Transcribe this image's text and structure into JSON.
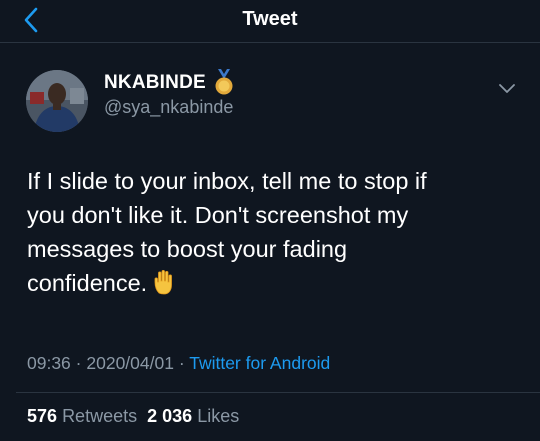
{
  "header": {
    "title": "Tweet",
    "back_icon": "chevron-left-icon"
  },
  "tweet": {
    "author": {
      "display_name": "NKABINDE",
      "handle": "@sya_nkabinde",
      "badge_icon": "medal-icon"
    },
    "text_lines": [
      "If I slide to your inbox, tell me to stop if",
      "you don't like it. Don't screenshot my",
      "messages to boost your fading",
      "confidence."
    ],
    "emoji_icon": "raised-hand-icon",
    "time": "09:36",
    "date": "2020/04/01",
    "separator": "·",
    "client": "Twitter for Android",
    "retweets_count": "576",
    "retweets_label": "Retweets",
    "likes_count": "2 036",
    "likes_label": "Likes"
  },
  "colors": {
    "background": "#0f1620",
    "accent": "#1d9bf0",
    "secondary_text": "#8b98a5",
    "divider": "#2a3440"
  }
}
